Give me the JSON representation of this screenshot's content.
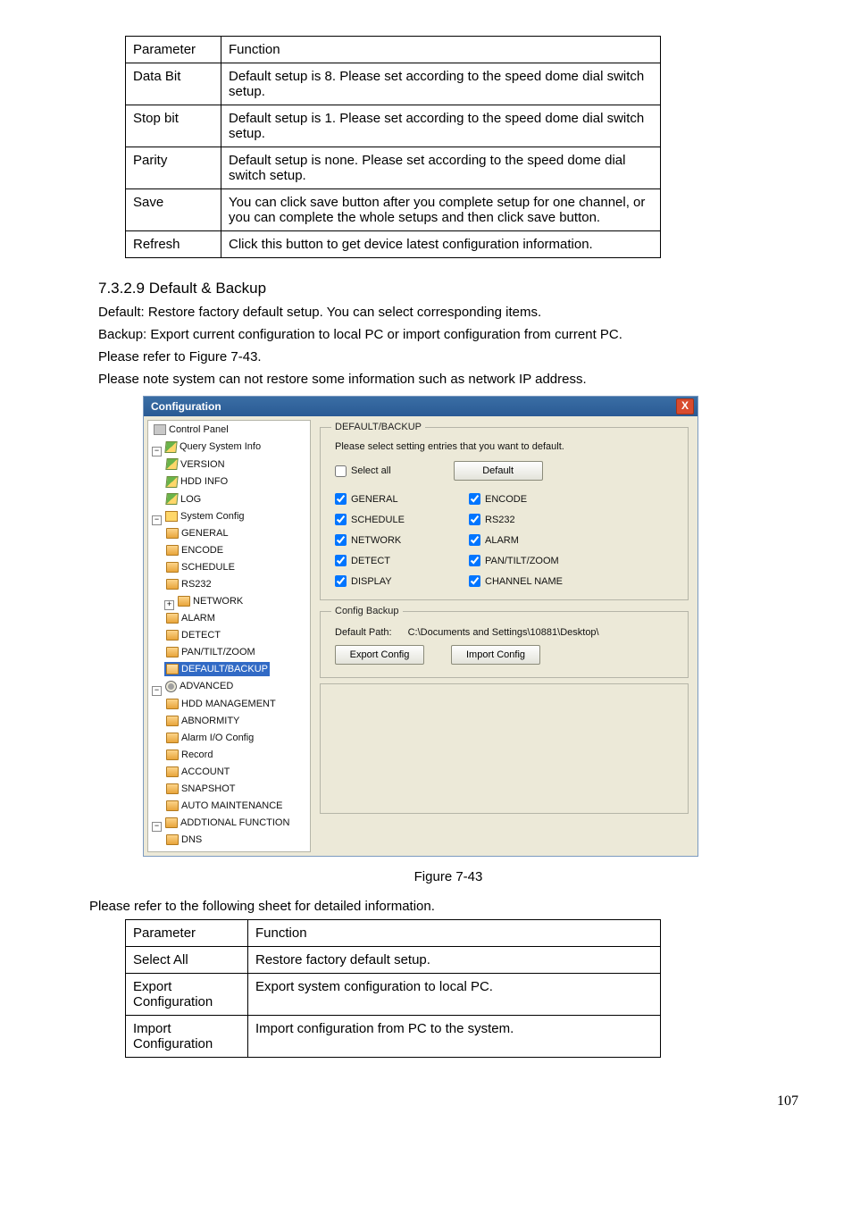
{
  "table1": {
    "h1": "Parameter",
    "h2": "Function",
    "rows": [
      {
        "p": "Data Bit",
        "f": "Default setup is 8. Please set according to the speed dome dial switch setup."
      },
      {
        "p": "Stop bit",
        "f": "Default setup is 1. Please set according to the speed dome dial switch setup."
      },
      {
        "p": "Parity",
        "f": "Default setup is none. Please set according to the speed dome dial switch setup."
      },
      {
        "p": "Save",
        "f": "You can click save button after you complete setup for one channel, or you can complete the whole setups and then click save button."
      },
      {
        "p": "Refresh",
        "f": "Click this button to get device latest configuration information."
      }
    ]
  },
  "section": {
    "heading": "7.3.2.9  Default & Backup",
    "line1": "Default: Restore factory default setup. You can select corresponding items.",
    "line2": "Backup: Export current configuration to local PC or import configuration from current PC.",
    "line3": "Please refer to Figure 7-43.",
    "line4": "Please note system can not restore some information such as network IP address."
  },
  "window": {
    "title": "Configuration",
    "close": "X",
    "tree": {
      "control_panel": "Control Panel",
      "query_sys_info": "Query System Info",
      "version": "VERSION",
      "hdd_info": "HDD INFO",
      "log": "LOG",
      "system_config": "System Config",
      "general": "GENERAL",
      "encode": "ENCODE",
      "schedule": "SCHEDULE",
      "rs232": "RS232",
      "network": "NETWORK",
      "alarm": "ALARM",
      "detect": "DETECT",
      "ptz": "PAN/TILT/ZOOM",
      "default_backup": "DEFAULT/BACKUP",
      "advanced": "ADVANCED",
      "hdd_mgmt": "HDD MANAGEMENT",
      "abnormity": "ABNORMITY",
      "alarm_io": "Alarm I/O Config",
      "record": "Record",
      "account": "ACCOUNT",
      "snapshot": "SNAPSHOT",
      "auto_maint": "AUTO MAINTENANCE",
      "additional": "ADDTIONAL FUNCTION",
      "dns": "DNS"
    },
    "panel": {
      "group1_title": "DEFAULT/BACKUP",
      "instruction": "Please select setting entries that you want to default.",
      "select_all": "Select all",
      "default_btn": "Default",
      "checks": {
        "general": "GENERAL",
        "encode": "ENCODE",
        "schedule": "SCHEDULE",
        "rs232": "RS232",
        "network": "NETWORK",
        "alarm": "ALARM",
        "detect": "DETECT",
        "ptz": "PAN/TILT/ZOOM",
        "display": "DISPLAY",
        "channel": "CHANNEL NAME"
      },
      "group2_title": "Config Backup",
      "path_label": "Default Path:",
      "path_value": "C:\\Documents and Settings\\10881\\Desktop\\",
      "export_btn": "Export Config",
      "import_btn": "Import Config"
    }
  },
  "figure_caption": "Figure 7-43",
  "after_figure": "Please refer to the following sheet for detailed information.",
  "table2": {
    "h1": "Parameter",
    "h2": "Function",
    "rows": [
      {
        "p": "Select All",
        "f": "Restore factory default setup."
      },
      {
        "p": "Export Configuration",
        "f": "Export system configuration to local PC."
      },
      {
        "p": "Import Configuration",
        "f": "Import configuration from PC to the system."
      }
    ]
  },
  "page_number": "107"
}
